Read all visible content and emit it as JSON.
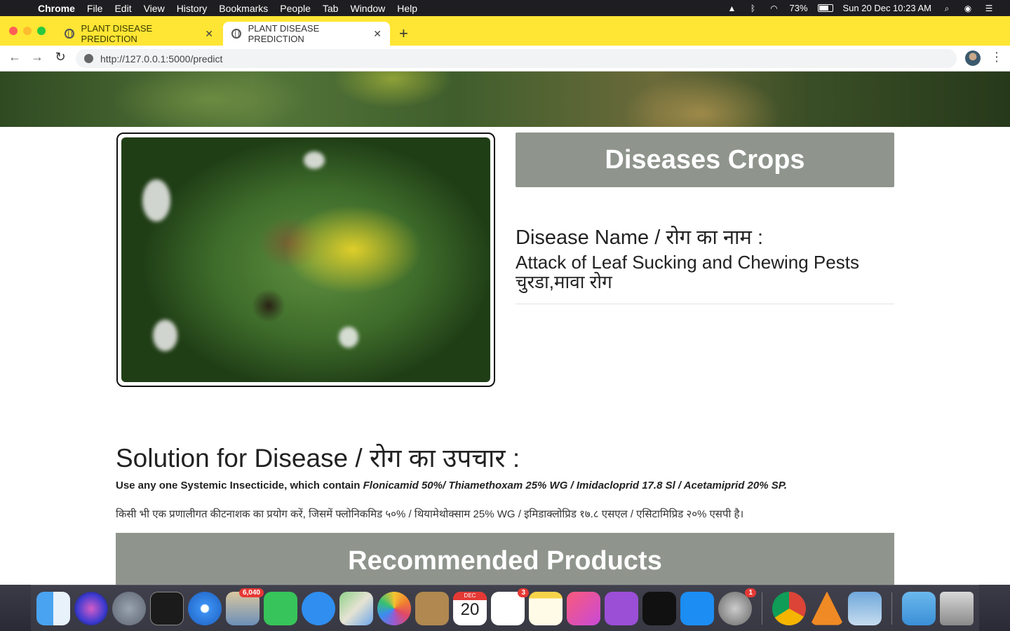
{
  "menubar": {
    "apple_glyph": "",
    "items": [
      "Chrome",
      "File",
      "Edit",
      "View",
      "History",
      "Bookmarks",
      "People",
      "Tab",
      "Window",
      "Help"
    ],
    "battery": "73%",
    "clock": "Sun 20 Dec  10:23 AM",
    "battery_level": 0.73
  },
  "browser": {
    "tabs": [
      {
        "title": "PLANT DISEASE PREDICTION",
        "active": false
      },
      {
        "title": "PLANT DISEASE PREDICTION",
        "active": true
      }
    ],
    "close_glyph": "✕",
    "new_tab_glyph": "+",
    "back_glyph": "←",
    "forward_glyph": "→",
    "reload_glyph": "↻",
    "menu_glyph": "⋮",
    "url": "http://127.0.0.1:5000/predict"
  },
  "page": {
    "card_title": "Diseases Crops",
    "disease_label": "Disease Name / रोग का नाम :",
    "disease_name_en": "Attack of Leaf Sucking and Chewing Pests",
    "disease_name_hi": "चुरडा,मावा रोग",
    "solution_title": "Solution for Disease / रोग का उपचार :",
    "solution_en_prefix": "Use any one Systemic Insecticide, which contain ",
    "solution_en_chemicals": "Flonicamid 50%/ Thiamethoxam 25% WG / Imidacloprid 17.8 Sl / Acetamiprid 20% SP.",
    "solution_hi": "किसी भी एक प्रणालीगत कीटनाशक का प्रयोग करें, जिसमें फ्लोनिकमिड ५०% / थियामेथोक्साम 25% WG / इमिडाक्लोप्रिड १७.८ एसएल / एसिटामिप्रिड २०% एसपी है।",
    "recommended_title": "Recommended Products"
  },
  "dock": {
    "mail_badge": "6,040",
    "calendar_month": "DEC",
    "calendar_day": "20",
    "reminders_badge": "3",
    "settings_badge": "1",
    "apps": [
      "finder-icon",
      "siri-icon",
      "launchpad-icon",
      "terminal-icon",
      "safari-icon",
      "mail-icon",
      "facetime-icon",
      "messages-icon",
      "maps-icon",
      "photos-icon",
      "contacts-icon",
      "calendar-icon",
      "reminders-icon",
      "notes-icon",
      "music-icon",
      "podcasts-icon",
      "tv-icon",
      "app-store-icon",
      "system-preferences-icon",
      "chrome-icon",
      "vlc-icon",
      "preview-icon",
      "downloads-folder-icon",
      "trash-icon"
    ]
  },
  "colors": {
    "tab_strip": "#ffe534",
    "card_bg": "#8f958d",
    "menubar_bg": "#1e1e22"
  }
}
